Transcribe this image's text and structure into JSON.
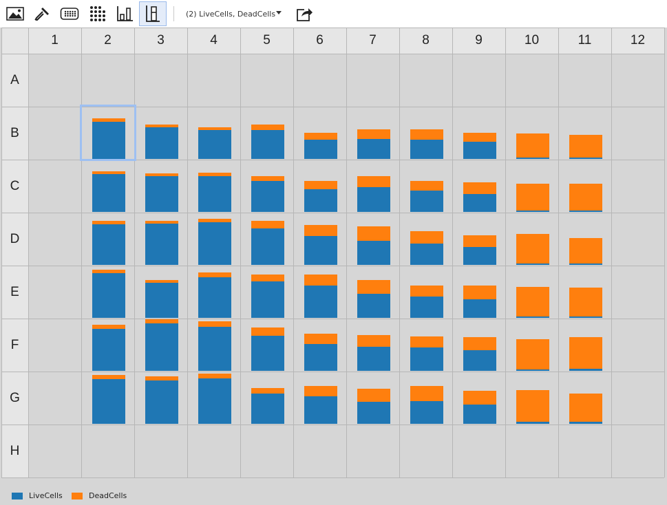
{
  "toolbar": {
    "buttons": [
      {
        "name": "image-view-icon",
        "active": false
      },
      {
        "name": "dropper-icon",
        "active": false
      },
      {
        "name": "plate-icon",
        "active": false
      },
      {
        "name": "dot-grid-icon",
        "active": false
      },
      {
        "name": "bar-chart-icon",
        "active": false
      },
      {
        "name": "stacked-bar-icon",
        "active": true
      },
      {
        "name": "export-icon",
        "active": false
      }
    ],
    "series_select": "(2) LiveCells, DeadCells"
  },
  "plate": {
    "columns": [
      "1",
      "2",
      "3",
      "4",
      "5",
      "6",
      "7",
      "8",
      "9",
      "10",
      "11",
      "12"
    ],
    "rows": [
      "A",
      "B",
      "C",
      "D",
      "E",
      "F",
      "G",
      "H"
    ],
    "selected_well": "B2",
    "colors": {
      "LiveCells": "#1f77b4",
      "DeadCells": "#ff7f0e"
    }
  },
  "chart_data": {
    "type": "bar",
    "subtype": "stacked",
    "scale_note": "values are fraction of well height",
    "series_names": [
      "LiveCells",
      "DeadCells"
    ],
    "wells": {
      "B2": [
        0.7,
        0.06
      ],
      "B3": [
        0.6,
        0.05
      ],
      "B4": [
        0.55,
        0.05
      ],
      "B5": [
        0.55,
        0.1
      ],
      "B6": [
        0.36,
        0.13
      ],
      "B7": [
        0.38,
        0.18
      ],
      "B8": [
        0.37,
        0.2
      ],
      "B9": [
        0.32,
        0.17
      ],
      "B10": [
        0.03,
        0.45
      ],
      "B11": [
        0.03,
        0.43
      ],
      "C2": [
        0.72,
        0.05
      ],
      "C3": [
        0.68,
        0.05
      ],
      "C4": [
        0.68,
        0.06
      ],
      "C5": [
        0.59,
        0.09
      ],
      "C6": [
        0.43,
        0.15
      ],
      "C7": [
        0.47,
        0.21
      ],
      "C8": [
        0.4,
        0.18
      ],
      "C9": [
        0.34,
        0.22
      ],
      "C10": [
        0.03,
        0.5
      ],
      "C11": [
        0.03,
        0.51
      ],
      "D2": [
        0.76,
        0.06
      ],
      "D3": [
        0.78,
        0.05
      ],
      "D4": [
        0.8,
        0.06
      ],
      "D5": [
        0.69,
        0.14
      ],
      "D6": [
        0.54,
        0.21
      ],
      "D7": [
        0.46,
        0.27
      ],
      "D8": [
        0.4,
        0.23
      ],
      "D9": [
        0.34,
        0.22
      ],
      "D10": [
        0.03,
        0.56
      ],
      "D11": [
        0.03,
        0.48
      ],
      "E2": [
        0.84,
        0.06
      ],
      "E3": [
        0.66,
        0.05
      ],
      "E4": [
        0.76,
        0.09
      ],
      "E5": [
        0.69,
        0.13
      ],
      "E6": [
        0.61,
        0.21
      ],
      "E7": [
        0.46,
        0.26
      ],
      "E8": [
        0.4,
        0.21
      ],
      "E9": [
        0.35,
        0.26
      ],
      "E10": [
        0.03,
        0.56
      ],
      "E11": [
        0.03,
        0.55
      ],
      "F2": [
        0.79,
        0.08
      ],
      "F3": [
        0.89,
        0.09
      ],
      "F4": [
        0.83,
        0.11
      ],
      "F5": [
        0.66,
        0.16
      ],
      "F6": [
        0.5,
        0.2
      ],
      "F7": [
        0.45,
        0.22
      ],
      "F8": [
        0.44,
        0.21
      ],
      "F9": [
        0.39,
        0.25
      ],
      "F10": [
        0.03,
        0.57
      ],
      "F11": [
        0.04,
        0.6
      ],
      "G2": [
        0.84,
        0.08
      ],
      "G3": [
        0.82,
        0.08
      ],
      "G4": [
        0.86,
        0.09
      ],
      "G5": [
        0.57,
        0.11
      ],
      "G6": [
        0.52,
        0.19
      ],
      "G7": [
        0.42,
        0.25
      ],
      "G8": [
        0.43,
        0.28
      ],
      "G9": [
        0.36,
        0.26
      ],
      "G10": [
        0.04,
        0.6
      ],
      "G11": [
        0.04,
        0.53
      ]
    }
  },
  "legend": {
    "items": [
      {
        "label": "LiveCells",
        "color": "#1f77b4"
      },
      {
        "label": "DeadCells",
        "color": "#ff7f0e"
      }
    ]
  }
}
